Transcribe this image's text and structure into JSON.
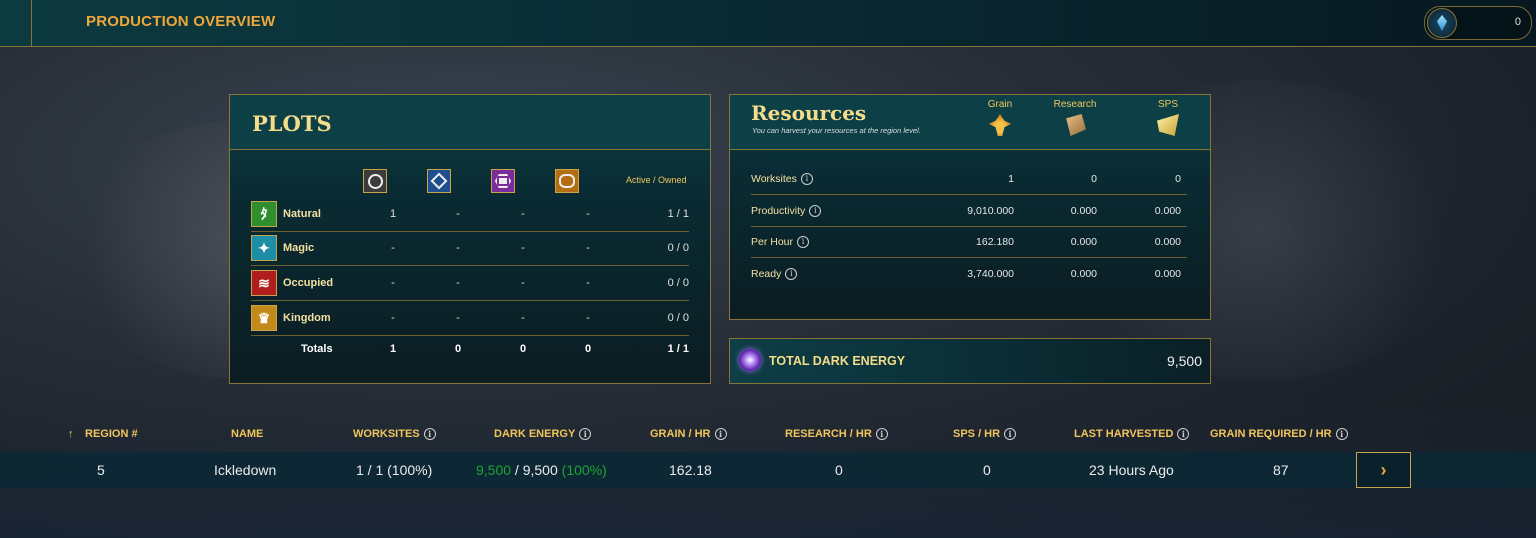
{
  "header": {
    "title": "PRODUCTION OVERVIEW",
    "currency_value": "0",
    "currency_icon": "gem-icon"
  },
  "plots": {
    "title": "PLOTS",
    "tiers": [
      "common",
      "rare",
      "epic",
      "legendary"
    ],
    "active_owned_label": "Active / Owned",
    "rows": [
      {
        "label": "Natural",
        "icon": "natural-icon",
        "values": [
          "1",
          "-",
          "-",
          "-"
        ],
        "total": "1 / 1"
      },
      {
        "label": "Magic",
        "icon": "magic-icon",
        "values": [
          "-",
          "-",
          "-",
          "-"
        ],
        "total": "0 / 0"
      },
      {
        "label": "Occupied",
        "icon": "occupied-icon",
        "values": [
          "-",
          "-",
          "-",
          "-"
        ],
        "total": "0 / 0"
      },
      {
        "label": "Kingdom",
        "icon": "kingdom-icon",
        "values": [
          "-",
          "-",
          "-",
          "-"
        ],
        "total": "0 / 0"
      }
    ],
    "totals": {
      "label": "Totals",
      "values": [
        "1",
        "0",
        "0",
        "0"
      ],
      "total": "1 / 1"
    }
  },
  "resources": {
    "title": "Resources",
    "subtitle": "You can harvest your resources at the region level.",
    "columns": [
      "Grain",
      "Research",
      "SPS"
    ],
    "rows": [
      {
        "label": "Worksites",
        "values": [
          "1",
          "0",
          "0"
        ]
      },
      {
        "label": "Productivity",
        "values": [
          "9,010.000",
          "0.000",
          "0.000"
        ]
      },
      {
        "label": "Per Hour",
        "values": [
          "162.180",
          "0.000",
          "0.000"
        ]
      },
      {
        "label": "Ready",
        "values": [
          "3,740.000",
          "0.000",
          "0.000"
        ]
      }
    ]
  },
  "dark_energy": {
    "label": "TOTAL DARK ENERGY",
    "value": "9,500"
  },
  "table": {
    "sort_arrow": "↑",
    "headers": {
      "region": "REGION #",
      "name": "NAME",
      "worksites": "WORKSITES",
      "dark_energy": "DARK ENERGY",
      "grain_hr": "GRAIN / HR",
      "research_hr": "RESEARCH / HR",
      "sps_hr": "SPS / HR",
      "last_harvested": "LAST HARVESTED",
      "grain_required": "GRAIN REQUIRED / HR"
    },
    "rows": [
      {
        "region": "5",
        "name": "Ickledown",
        "worksites": "1 / 1 (100%)",
        "dark_energy_current": "9,500",
        "dark_energy_sep": " / ",
        "dark_energy_total": "9,500",
        "dark_energy_pct": " (100%)",
        "grain_hr": "162.18",
        "research_hr": "0",
        "sps_hr": "0",
        "last_harvested": "23 Hours Ago",
        "grain_required": "87",
        "action": "›"
      }
    ]
  },
  "info_glyph": "i",
  "colors": {
    "accent_gold": "#f0c65a",
    "title_orange": "#f0a73a",
    "panel_border": "#8a7434",
    "positive_green": "#1fa233"
  }
}
